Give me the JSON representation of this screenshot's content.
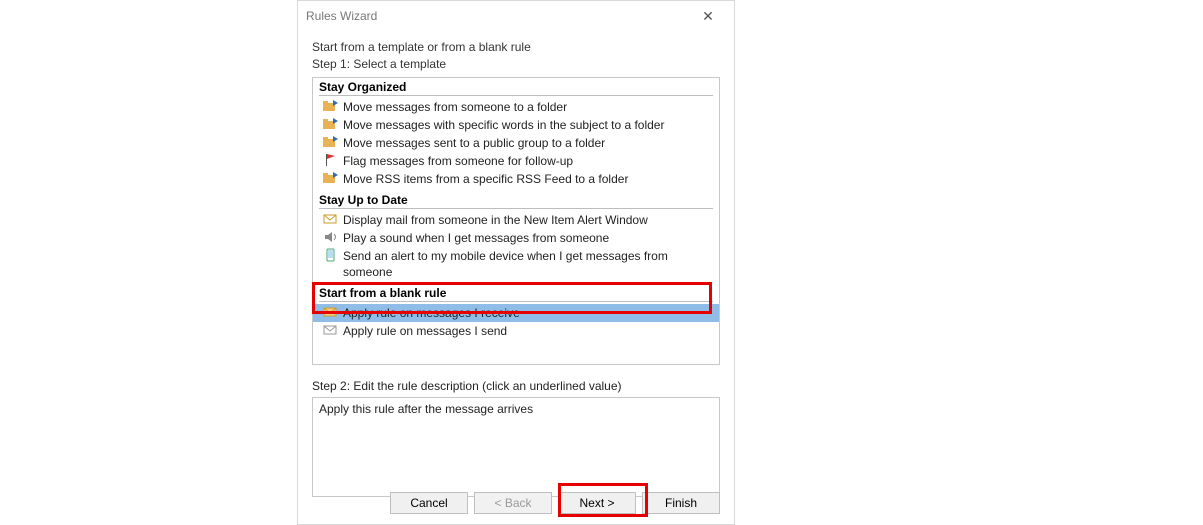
{
  "window": {
    "title": "Rules Wizard"
  },
  "intro": {
    "line1": "Start from a template or from a blank rule",
    "line2": "Step 1: Select a template"
  },
  "sections": {
    "organized": {
      "header": "Stay Organized",
      "items": [
        "Move messages from someone to a folder",
        "Move messages with specific words in the subject to a folder",
        "Move messages sent to a public group to a folder",
        "Flag messages from someone for follow-up",
        "Move RSS items from a specific RSS Feed to a folder"
      ]
    },
    "uptodate": {
      "header": "Stay Up to Date",
      "items": [
        "Display mail from someone in the New Item Alert Window",
        "Play a sound when I get messages from someone",
        "Send an alert to my mobile device when I get messages from someone"
      ]
    },
    "blank": {
      "header": "Start from a blank rule",
      "items": [
        "Apply rule on messages I receive",
        "Apply rule on messages I send"
      ]
    }
  },
  "step2": {
    "label": "Step 2: Edit the rule description (click an underlined value)",
    "content": "Apply this rule after the message arrives"
  },
  "buttons": {
    "cancel": "Cancel",
    "back": "< Back",
    "next": "Next >",
    "finish": "Finish"
  }
}
